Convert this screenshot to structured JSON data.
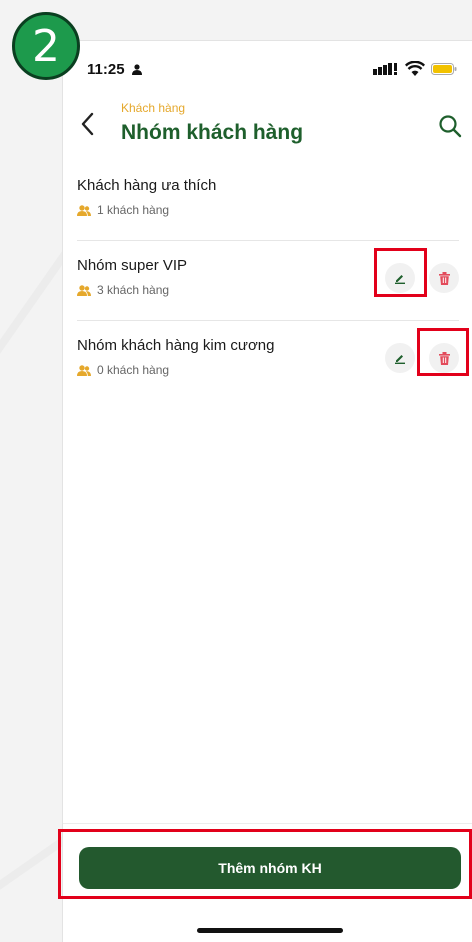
{
  "step_badge": "2",
  "status_bar": {
    "time": "11:25"
  },
  "header": {
    "breadcrumb": "Khách hàng",
    "title": "Nhóm khách hàng"
  },
  "groups": [
    {
      "name": "Khách hàng ưa thích",
      "count": "1 khách hàng"
    },
    {
      "name": "Nhóm super VIP",
      "count": "3 khách hàng"
    },
    {
      "name": "Nhóm khách hàng kim cương",
      "count": "0 khách hàng"
    }
  ],
  "add_button_label": "Thêm nhóm KH",
  "colors": {
    "primary": "#23592e",
    "title": "#1e5f2c",
    "accent": "#e5a82c",
    "delete": "#e34b5b",
    "highlight": "#e2001a",
    "badge": "#1d9a4c"
  },
  "icons": {
    "back": "chevron-left-icon",
    "search": "search-icon",
    "users": "users-icon",
    "edit": "pencil-icon",
    "delete": "trash-icon"
  }
}
